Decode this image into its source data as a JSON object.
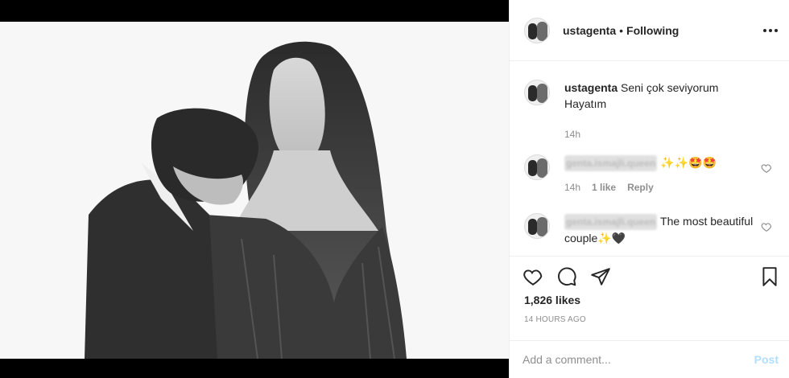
{
  "post": {
    "username": "ustagenta",
    "separator": "•",
    "follow_status": "Following"
  },
  "caption": {
    "username": "ustagenta",
    "text": "Seni çok seviyorum Hayatım",
    "time": "14h"
  },
  "comments": [
    {
      "username": "genta.ismajli.queen",
      "text": "✨✨🤩🤩",
      "time": "14h",
      "likes": "1 like",
      "reply": "Reply"
    },
    {
      "username": "genta.ismajli.queen",
      "text": "The most beautiful couple✨🖤"
    }
  ],
  "engagement": {
    "likes": "1,826 likes",
    "time_ago": "14 HOURS AGO"
  },
  "add_comment": {
    "placeholder": "Add a comment...",
    "post_label": "Post"
  },
  "colors": {
    "text": "#262626",
    "secondary": "#8e8e8e",
    "post_disabled": "#b2dffc",
    "border": "#efefef"
  },
  "icons": [
    "more-options-icon",
    "like-icon",
    "comment-icon",
    "share-icon",
    "bookmark-icon",
    "comment-like-icon"
  ]
}
